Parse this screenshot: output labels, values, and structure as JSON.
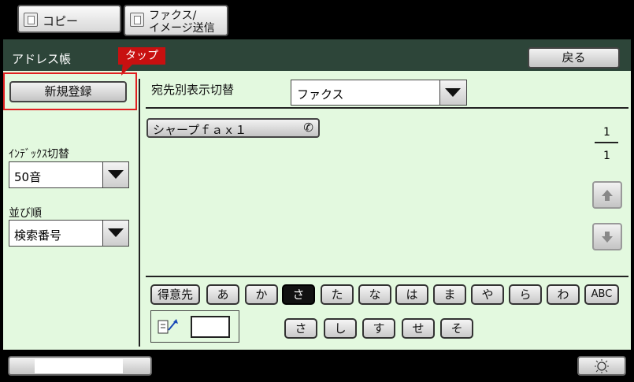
{
  "tabs": [
    {
      "label": "コピー",
      "icon": "copy-icon"
    },
    {
      "label_line1": "ファクス/",
      "label_line2": "イメージ送信",
      "icon": "fax-image-send-icon"
    }
  ],
  "title": "アドレス帳",
  "tooltip": "タップ",
  "back_button": "戻る",
  "new_register_button": "新規登録",
  "display_switch": {
    "label": "宛先別表示切替",
    "value": "ファクス"
  },
  "index_switch": {
    "label": "ｲﾝﾃﾞｯｸｽ切替",
    "value": "50音"
  },
  "sort_order": {
    "label": "並び順",
    "value": "検索番号"
  },
  "entries": [
    {
      "name": "シャープｆａｘ１",
      "icon": "phone-icon"
    }
  ],
  "pagination": {
    "current": "1",
    "total": "1"
  },
  "kana_row": [
    "得意先",
    "あ",
    "か",
    "さ",
    "た",
    "な",
    "は",
    "ま",
    "や",
    "ら",
    "わ",
    "ABC"
  ],
  "active_kana": "さ",
  "sub_kana_row": [
    "さ",
    "し",
    "す",
    "せ",
    "そ"
  ],
  "colors": {
    "panel_bg": "#e3f9df",
    "title_bg": "#2d4539",
    "highlight": "#e02020",
    "tooltip_bg": "#c81010"
  }
}
